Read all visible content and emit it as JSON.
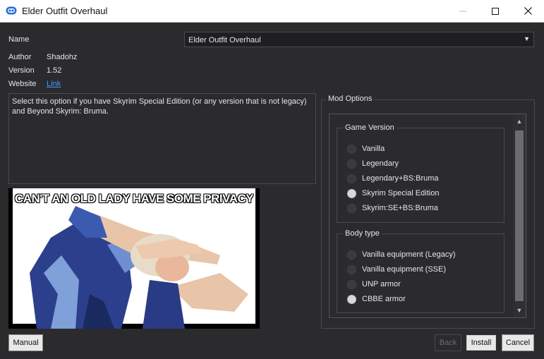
{
  "window": {
    "title": "Elder Outfit Overhaul",
    "icon": "app-cloud-icon",
    "controls": [
      "minimize-icon",
      "maximize-icon",
      "close-icon"
    ]
  },
  "info": {
    "name_label": "Name",
    "name_value": "Elder Outfit Overhaul",
    "author_label": "Author",
    "author_value": "Shadohz",
    "version_label": "Version",
    "version_value": "1.52",
    "website_label": "Website",
    "website_link": "Link"
  },
  "description": "Select this option if you have Skyrim Special Edition (or any version that is not legacy) and Beyond Skyrim: Bruma.",
  "preview": {
    "caption": "CAN'T AN OLD LADY HAVE SOME PRIVACY"
  },
  "mod_options": {
    "title": "Mod Options",
    "groups": [
      {
        "title": "Game Version",
        "options": [
          {
            "label": "Vanilla",
            "selected": false
          },
          {
            "label": "Legendary",
            "selected": false
          },
          {
            "label": "Legendary+BS:Bruma",
            "selected": false
          },
          {
            "label": "Skyrim Special Edition",
            "selected": true
          },
          {
            "label": "Skyrim:SE+BS:Bruma",
            "selected": false
          }
        ]
      },
      {
        "title": "Body type",
        "options": [
          {
            "label": "Vanilla equipment (Legacy)",
            "selected": false
          },
          {
            "label": "Vanilla equipment (SSE)",
            "selected": false
          },
          {
            "label": "UNP armor",
            "selected": false
          },
          {
            "label": "CBBE armor",
            "selected": true
          }
        ]
      }
    ]
  },
  "buttons": {
    "manual": "Manual",
    "back": "Back",
    "install": "Install",
    "cancel": "Cancel"
  },
  "colors": {
    "background": "#2b2b2e",
    "link": "#3b9bff",
    "selected_radio": "#d8d8d8"
  }
}
